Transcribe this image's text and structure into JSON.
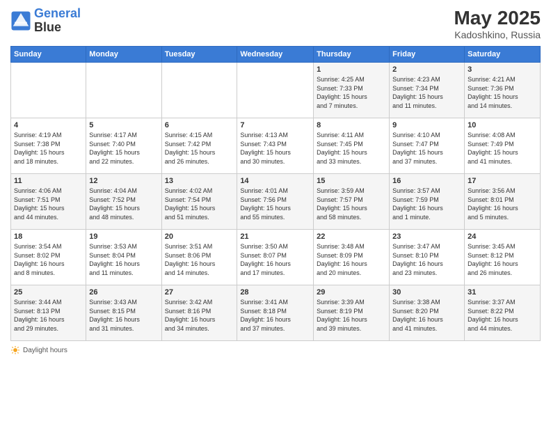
{
  "header": {
    "logo_line1": "General",
    "logo_line2": "Blue",
    "main_title": "May 2025",
    "subtitle": "Kadoshkino, Russia"
  },
  "days_of_week": [
    "Sunday",
    "Monday",
    "Tuesday",
    "Wednesday",
    "Thursday",
    "Friday",
    "Saturday"
  ],
  "weeks": [
    {
      "cells": [
        {
          "day": "",
          "info": ""
        },
        {
          "day": "",
          "info": ""
        },
        {
          "day": "",
          "info": ""
        },
        {
          "day": "",
          "info": ""
        },
        {
          "day": "1",
          "info": "Sunrise: 4:25 AM\nSunset: 7:33 PM\nDaylight: 15 hours\nand 7 minutes."
        },
        {
          "day": "2",
          "info": "Sunrise: 4:23 AM\nSunset: 7:34 PM\nDaylight: 15 hours\nand 11 minutes."
        },
        {
          "day": "3",
          "info": "Sunrise: 4:21 AM\nSunset: 7:36 PM\nDaylight: 15 hours\nand 14 minutes."
        }
      ]
    },
    {
      "cells": [
        {
          "day": "4",
          "info": "Sunrise: 4:19 AM\nSunset: 7:38 PM\nDaylight: 15 hours\nand 18 minutes."
        },
        {
          "day": "5",
          "info": "Sunrise: 4:17 AM\nSunset: 7:40 PM\nDaylight: 15 hours\nand 22 minutes."
        },
        {
          "day": "6",
          "info": "Sunrise: 4:15 AM\nSunset: 7:42 PM\nDaylight: 15 hours\nand 26 minutes."
        },
        {
          "day": "7",
          "info": "Sunrise: 4:13 AM\nSunset: 7:43 PM\nDaylight: 15 hours\nand 30 minutes."
        },
        {
          "day": "8",
          "info": "Sunrise: 4:11 AM\nSunset: 7:45 PM\nDaylight: 15 hours\nand 33 minutes."
        },
        {
          "day": "9",
          "info": "Sunrise: 4:10 AM\nSunset: 7:47 PM\nDaylight: 15 hours\nand 37 minutes."
        },
        {
          "day": "10",
          "info": "Sunrise: 4:08 AM\nSunset: 7:49 PM\nDaylight: 15 hours\nand 41 minutes."
        }
      ]
    },
    {
      "cells": [
        {
          "day": "11",
          "info": "Sunrise: 4:06 AM\nSunset: 7:51 PM\nDaylight: 15 hours\nand 44 minutes."
        },
        {
          "day": "12",
          "info": "Sunrise: 4:04 AM\nSunset: 7:52 PM\nDaylight: 15 hours\nand 48 minutes."
        },
        {
          "day": "13",
          "info": "Sunrise: 4:02 AM\nSunset: 7:54 PM\nDaylight: 15 hours\nand 51 minutes."
        },
        {
          "day": "14",
          "info": "Sunrise: 4:01 AM\nSunset: 7:56 PM\nDaylight: 15 hours\nand 55 minutes."
        },
        {
          "day": "15",
          "info": "Sunrise: 3:59 AM\nSunset: 7:57 PM\nDaylight: 15 hours\nand 58 minutes."
        },
        {
          "day": "16",
          "info": "Sunrise: 3:57 AM\nSunset: 7:59 PM\nDaylight: 16 hours\nand 1 minute."
        },
        {
          "day": "17",
          "info": "Sunrise: 3:56 AM\nSunset: 8:01 PM\nDaylight: 16 hours\nand 5 minutes."
        }
      ]
    },
    {
      "cells": [
        {
          "day": "18",
          "info": "Sunrise: 3:54 AM\nSunset: 8:02 PM\nDaylight: 16 hours\nand 8 minutes."
        },
        {
          "day": "19",
          "info": "Sunrise: 3:53 AM\nSunset: 8:04 PM\nDaylight: 16 hours\nand 11 minutes."
        },
        {
          "day": "20",
          "info": "Sunrise: 3:51 AM\nSunset: 8:06 PM\nDaylight: 16 hours\nand 14 minutes."
        },
        {
          "day": "21",
          "info": "Sunrise: 3:50 AM\nSunset: 8:07 PM\nDaylight: 16 hours\nand 17 minutes."
        },
        {
          "day": "22",
          "info": "Sunrise: 3:48 AM\nSunset: 8:09 PM\nDaylight: 16 hours\nand 20 minutes."
        },
        {
          "day": "23",
          "info": "Sunrise: 3:47 AM\nSunset: 8:10 PM\nDaylight: 16 hours\nand 23 minutes."
        },
        {
          "day": "24",
          "info": "Sunrise: 3:45 AM\nSunset: 8:12 PM\nDaylight: 16 hours\nand 26 minutes."
        }
      ]
    },
    {
      "cells": [
        {
          "day": "25",
          "info": "Sunrise: 3:44 AM\nSunset: 8:13 PM\nDaylight: 16 hours\nand 29 minutes."
        },
        {
          "day": "26",
          "info": "Sunrise: 3:43 AM\nSunset: 8:15 PM\nDaylight: 16 hours\nand 31 minutes."
        },
        {
          "day": "27",
          "info": "Sunrise: 3:42 AM\nSunset: 8:16 PM\nDaylight: 16 hours\nand 34 minutes."
        },
        {
          "day": "28",
          "info": "Sunrise: 3:41 AM\nSunset: 8:18 PM\nDaylight: 16 hours\nand 37 minutes."
        },
        {
          "day": "29",
          "info": "Sunrise: 3:39 AM\nSunset: 8:19 PM\nDaylight: 16 hours\nand 39 minutes."
        },
        {
          "day": "30",
          "info": "Sunrise: 3:38 AM\nSunset: 8:20 PM\nDaylight: 16 hours\nand 41 minutes."
        },
        {
          "day": "31",
          "info": "Sunrise: 3:37 AM\nSunset: 8:22 PM\nDaylight: 16 hours\nand 44 minutes."
        }
      ]
    }
  ],
  "footer": {
    "label": "Daylight hours"
  },
  "colors": {
    "header_bg": "#3a7bd5",
    "accent": "#3a7bd5"
  }
}
